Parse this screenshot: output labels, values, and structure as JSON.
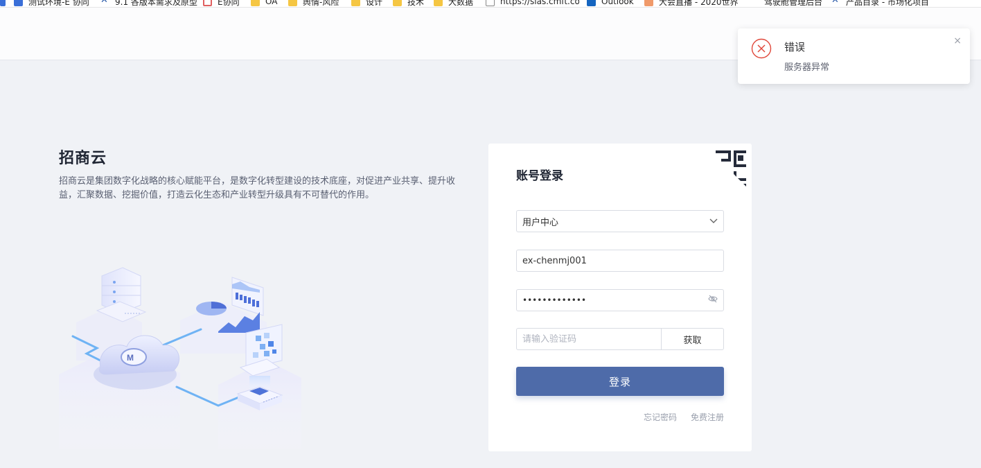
{
  "bookmarks": [
    {
      "label": "测试环境-E 协同",
      "icon": "check-shield-icon"
    },
    {
      "label": "9.1 各版本需求及原型",
      "icon": "tool-icon"
    },
    {
      "label": "E协同",
      "icon": "e-icon"
    },
    {
      "label": "OA",
      "icon": "folder-icon"
    },
    {
      "label": "舆情-风险",
      "icon": "folder-icon"
    },
    {
      "label": "设计",
      "icon": "folder-icon"
    },
    {
      "label": "技术",
      "icon": "folder-icon"
    },
    {
      "label": "大数据",
      "icon": "folder-icon"
    },
    {
      "label": "https://slas.cmft.com",
      "icon": "page-icon"
    },
    {
      "label": "Outlook",
      "icon": "outlook-icon"
    },
    {
      "label": "大会直播 - 2020世界",
      "icon": "live-icon"
    },
    {
      "label": "驾驶舱管理后台",
      "icon": "none"
    },
    {
      "label": "产品目录 - 市场化项目",
      "icon": "tool-icon"
    }
  ],
  "hero": {
    "title": "招商云",
    "description": "招商云是集团数字化战略的核心赋能平台，是数字化转型建设的技术底座，对促进产业共享、提升收益，汇聚数据、挖掘价值，打造云化生态和产业转型升级具有不可替代的作用。"
  },
  "login": {
    "title": "账号登录",
    "select_value": "用户中心",
    "username": "ex-chenmj001",
    "password_mask": "•••••••••••••",
    "code_placeholder": "请输入验证码",
    "get_code_label": "获取",
    "submit_label": "登录",
    "forgot_label": "忘记密码",
    "register_label": "免费注册"
  },
  "toast": {
    "title": "错误",
    "message": "服务器异常",
    "close_glyph": "×"
  },
  "colors": {
    "primary": "#4e6ba9",
    "error": "#e0473a",
    "page_bg": "#f0f2f6"
  }
}
